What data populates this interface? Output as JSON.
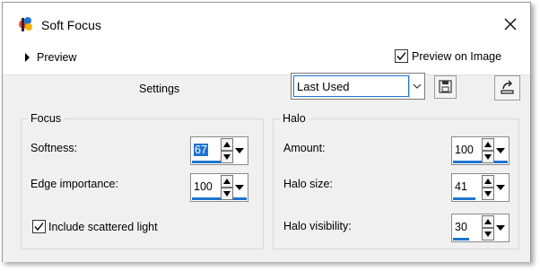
{
  "window": {
    "title": "Soft Focus"
  },
  "preview": {
    "label": "Preview",
    "preview_on_image_label": "Preview on Image",
    "preview_on_image_checked": true
  },
  "settings": {
    "label": "Settings",
    "preset_value": "Last Used"
  },
  "focus_group": {
    "title": "Focus",
    "softness": {
      "label": "Softness:",
      "value": "67",
      "fill": 0.67
    },
    "edge_importance": {
      "label": "Edge importance:",
      "value": "100",
      "fill": 1.0
    },
    "scattered_light": {
      "label": "Include scattered light",
      "checked": true
    }
  },
  "halo_group": {
    "title": "Halo",
    "amount": {
      "label": "Amount:",
      "value": "100",
      "fill": 1.0
    },
    "halo_size": {
      "label": "Halo size:",
      "value": "41",
      "fill": 0.41
    },
    "halo_visibility": {
      "label": "Halo visibility:",
      "value": "30",
      "fill": 0.3
    }
  },
  "icons": {
    "app": "paintshop-icon",
    "close": "close-icon",
    "expand": "triangle-right-icon",
    "dropdown": "chevron-down-icon",
    "save": "floppy-disk-icon",
    "reset": "reset-icon",
    "up": "spin-up-icon",
    "down": "spin-down-icon"
  },
  "colors": {
    "accent": "#1e74d0",
    "panel": "#f0f0f0"
  }
}
